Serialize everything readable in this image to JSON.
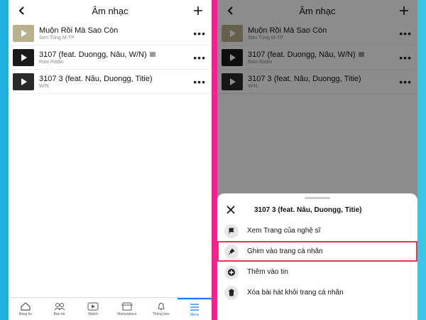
{
  "screen_title": "Âm nhạc",
  "songs": [
    {
      "title": "Muộn Rồi Mà Sao Còn",
      "artist": "Sơn Tùng M-TP",
      "thumb_color": "#b9b08e",
      "badge": false
    },
    {
      "title": "3107 (feat. Duongg, Nâu, W/N)",
      "artist": "Raw Radio",
      "thumb_color": "#1a1a1a",
      "badge": true
    },
    {
      "title": "3107 3 (feat. Nâu, Duongg, Titie)",
      "artist": "W/N",
      "thumb_color": "#2a2a2a",
      "badge": false
    }
  ],
  "tabs": [
    {
      "label": "Bảng tin",
      "icon": "home-icon"
    },
    {
      "label": "Bạn bè",
      "icon": "friends-icon"
    },
    {
      "label": "Watch",
      "icon": "watch-icon"
    },
    {
      "label": "Marketplace",
      "icon": "marketplace-icon"
    },
    {
      "label": "Thông báo",
      "icon": "bell-icon"
    },
    {
      "label": "Menu",
      "icon": "menu-icon"
    }
  ],
  "sheet": {
    "title": "3107 3 (feat. Nâu, Duongg, Titie)",
    "options": [
      {
        "label": "Xem Trang của nghệ sĩ",
        "icon": "flag-icon"
      },
      {
        "label": "Ghim vào trang cá nhân",
        "icon": "pin-icon"
      },
      {
        "label": "Thêm vào tin",
        "icon": "plus-circle-icon"
      },
      {
        "label": "Xóa bài hát khỏi trang cá nhân",
        "icon": "trash-icon"
      }
    ]
  },
  "colors": {
    "accent": "#1877f2",
    "highlight": "#e03a4e"
  }
}
